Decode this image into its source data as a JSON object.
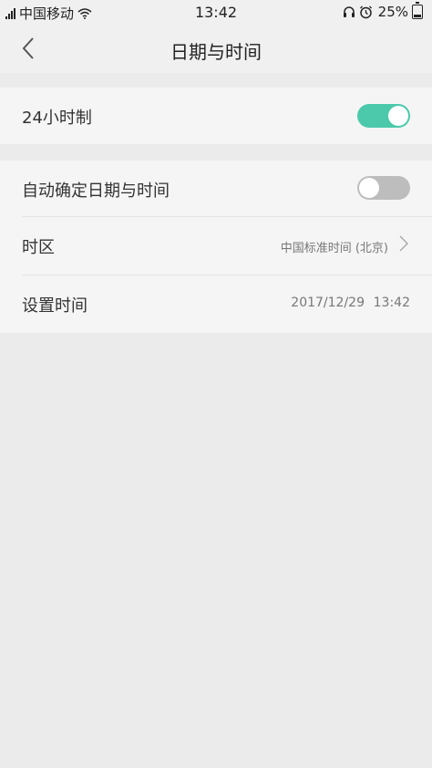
{
  "status_bar": {
    "carrier": "中国移动",
    "time": "13:42",
    "battery_percent": "25%",
    "battery_level": 0.25,
    "icons": [
      "signal-icon",
      "wifi-icon",
      "headset-icon",
      "alarm-icon",
      "battery-icon"
    ]
  },
  "nav": {
    "title": "日期与时间",
    "back_icon": "back-arrow-icon"
  },
  "settings": {
    "hour24": {
      "label": "24小时制",
      "enabled": true
    },
    "auto_datetime": {
      "label": "自动确定日期与时间",
      "enabled": false
    },
    "timezone": {
      "label": "时区",
      "value": "中国标准时间 (北京)"
    },
    "set_time": {
      "label": "设置时间",
      "date": "2017/12/29",
      "time": "13:42"
    }
  },
  "colors": {
    "toggle_on": "#4cc9ab",
    "toggle_off": "#bdbdbd",
    "background": "#ebebeb"
  }
}
